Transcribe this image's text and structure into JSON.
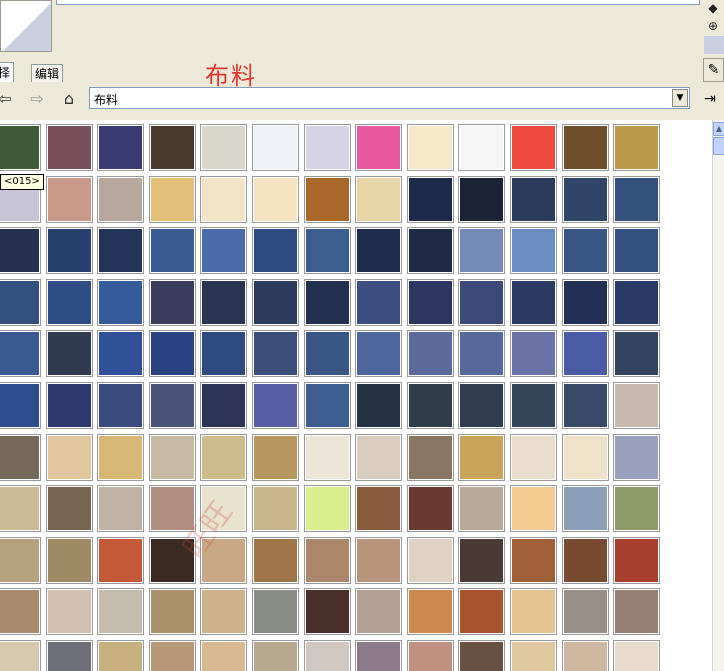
{
  "window": {
    "category_title": "布料",
    "tooltip_text": "<015>"
  },
  "tabs": [
    {
      "label": "选择",
      "active": true
    },
    {
      "label": "编辑",
      "active": false
    }
  ],
  "nav": {
    "back_icon": "back-arrow-icon",
    "forward_icon": "forward-arrow-icon",
    "home_icon": "home-icon",
    "location_value": "布料",
    "details_icon": "details-arrow-icon"
  },
  "side_icons": [
    "paint-bucket-icon",
    "create-material-icon"
  ],
  "watermark": "旺旺",
  "swatches": [
    [
      "#3f5b36",
      "#7a4f5c",
      "#3b3b73",
      "#4a3a2e",
      "#d9d6cc",
      "#eef2f8",
      "#d7d3e6",
      "#e85aa0",
      "#f4e8c8",
      "#f6f6f6",
      "#ec4a3e",
      "#6f4f2b",
      "#b89a4a"
    ],
    [
      "#c8c6d4",
      "#c99a8a",
      "#b8a79c",
      "#e2c07a",
      "#f3e4c9",
      "#f4e2c0",
      "#a9672a",
      "#e8d6a8",
      "#1d2a4a",
      "#1a2436",
      "#2b3b5a",
      "#2f4669",
      "#34507d"
    ],
    [
      "#27324f",
      "#27406e",
      "#22345a",
      "#3a5b93",
      "#4b6ba8",
      "#2e4a7f",
      "#3c5e8f",
      "#1e2d4d",
      "#1f2a44",
      "#7389b8",
      "#6b8bc4",
      "#3a5686",
      "#34507e"
    ],
    [
      "#34507e",
      "#2e4d85",
      "#365b9b",
      "#3a3e5c",
      "#2a3551",
      "#2c3a5c",
      "#23304f",
      "#3a4e7f",
      "#2d3660",
      "#3b4a78",
      "#2a3a63",
      "#223056",
      "#2a3a66"
    ],
    [
      "#3b5a94",
      "#2f3a52",
      "#30509a",
      "#2a4280",
      "#2f4a7e",
      "#3a4e7a",
      "#3a5687",
      "#4d669c",
      "#5a6a9a",
      "#56699b",
      "#6a72a6",
      "#4a5da4",
      "#33445e"
    ],
    [
      "#2f4d8c",
      "#2e3a6e",
      "#3a4c7d",
      "#4a5479",
      "#2e3358",
      "#575fa4",
      "#3f5f93",
      "#243243",
      "#2f3c4a",
      "#2f3d4f",
      "#32455b",
      "#394a69",
      "#c8b9ae"
    ],
    [
      "#756a5a",
      "#e0c7a0",
      "#d6b874",
      "#c8b9a2",
      "#cdbb8b",
      "#b89860",
      "#ede6d8",
      "#d8ccbf",
      "#8a7762",
      "#c8a55a",
      "#eadfcf",
      "#efe2c8",
      "#9aa1bd"
    ],
    [
      "#cdbb98",
      "#7a6650",
      "#bfb2a4",
      "#b08e80",
      "#e9e2cd",
      "#cbb78c",
      "#d9ef8e",
      "#8a5a3c",
      "#6b3a2e",
      "#b8a999",
      "#f2cc92",
      "#8aa0b8",
      "#8d9a6a"
    ],
    [
      "#b7a07d",
      "#a08a66",
      "#c55a3a",
      "#3a2a22",
      "#c9a888",
      "#a0754b",
      "#ad876b",
      "#b9947c",
      "#e0d2c2",
      "#4a3a36",
      "#a0603a",
      "#7a4a30",
      "#a8402e"
    ],
    [
      "#a88a6e",
      "#d4c0b0",
      "#c6bcae",
      "#a89068",
      "#cdb38a",
      "#8a8e86",
      "#4a2e2a",
      "#b49f94",
      "#cc8a4e",
      "#a8542e",
      "#e3c38e",
      "#9a8f87",
      "#9a8074"
    ],
    [
      "#d8c8b0",
      "#6e6e78",
      "#c8b080",
      "#b89878",
      "#d8b890",
      "#b8a890",
      "#d0c8c0",
      "#8a7a8a",
      "#c09080",
      "#6a5040",
      "#e0c8a0",
      "#d0b8a0",
      "#e8dccc"
    ]
  ]
}
